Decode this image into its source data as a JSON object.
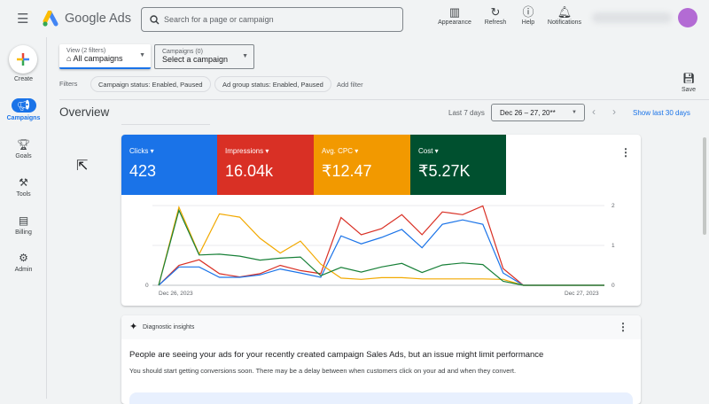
{
  "header": {
    "app_name": "Google Ads",
    "search_placeholder": "Search for a page or campaign",
    "actions": [
      {
        "label": "Appearance",
        "icon": "appearance-icon"
      },
      {
        "label": "Refresh",
        "icon": "refresh-icon"
      },
      {
        "label": "Help",
        "icon": "help-icon"
      },
      {
        "label": "Notifications",
        "icon": "bell-icon"
      }
    ]
  },
  "sidebar": {
    "create_label": "Create",
    "items": [
      {
        "label": "Campaigns",
        "icon": "megaphone-icon",
        "active": true
      },
      {
        "label": "Goals",
        "icon": "trophy-icon"
      },
      {
        "label": "Tools",
        "icon": "tools-icon"
      },
      {
        "label": "Billing",
        "icon": "credit-card-icon"
      },
      {
        "label": "Admin",
        "icon": "gear-icon"
      }
    ]
  },
  "toolbar": {
    "view_label": "View (2 filters)",
    "view_value": "All campaigns",
    "campaigns_label": "Campaigns (0)",
    "campaigns_value": "Select a campaign",
    "filters_label": "Filters",
    "filters": [
      "Campaign status: Enabled, Paused",
      "Ad group status: Enabled, Paused"
    ],
    "add_filter": "Add filter",
    "save_label": "Save"
  },
  "overview": {
    "title": "Overview",
    "range_label": "Last 7 days",
    "range_value": "Dec 26 – 27, 20**",
    "show_last_30": "Show last 30 days"
  },
  "metrics": [
    {
      "label": "Clicks",
      "value": "423",
      "color": "#1a73e8"
    },
    {
      "label": "Impressions",
      "value": "16.04k",
      "color": "#d93025"
    },
    {
      "label": "Avg. CPC",
      "value": "₹12.47",
      "color": "#f29900"
    },
    {
      "label": "Cost",
      "value": "₹5.27K",
      "color": "#00502f"
    }
  ],
  "chart_data": {
    "type": "line",
    "x_start_label": "Dec 26, 2023",
    "x_end_label": "Dec 27, 2023",
    "left_ticks": [
      "0"
    ],
    "right_ticks": [
      "0",
      "1",
      "2"
    ],
    "ylim": [
      0,
      2
    ],
    "grid": true,
    "series": [
      {
        "color": "#d93025",
        "values": [
          0,
          0.5,
          0.64,
          0.29,
          0.21,
          0.29,
          0.5,
          0.37,
          0.29,
          1.7,
          1.27,
          1.42,
          1.77,
          1.27,
          1.84,
          1.77,
          1.99,
          0.42,
          0,
          0,
          0,
          0,
          0
        ]
      },
      {
        "color": "#1a73e8",
        "values": [
          0,
          0.46,
          0.46,
          0.2,
          0.2,
          0.26,
          0.41,
          0.31,
          0.2,
          1.24,
          1.04,
          1.2,
          1.4,
          0.94,
          1.53,
          1.64,
          1.53,
          0.31,
          0,
          0,
          0,
          0,
          0
        ]
      },
      {
        "color": "#f2a900",
        "values": [
          0,
          1.96,
          0.78,
          1.79,
          1.71,
          1.18,
          0.81,
          1.11,
          0.53,
          0.18,
          0.15,
          0.19,
          0.19,
          0.16,
          0.16,
          0.16,
          0.16,
          0.15,
          0,
          0,
          0,
          0,
          0
        ]
      },
      {
        "color": "#188038",
        "values": [
          0,
          1.88,
          0.76,
          0.78,
          0.73,
          0.63,
          0.68,
          0.71,
          0.24,
          0.45,
          0.33,
          0.46,
          0.55,
          0.32,
          0.51,
          0.56,
          0.52,
          0.1,
          0,
          0,
          0,
          0,
          0
        ]
      }
    ]
  },
  "insights": {
    "header": "Diagnostic insights",
    "title": "People are seeing your ads for your recently created campaign Sales Ads, but an issue might limit performance",
    "body": "You should start getting conversions soon. There may be a delay between when customers click on your ad and when they convert."
  }
}
